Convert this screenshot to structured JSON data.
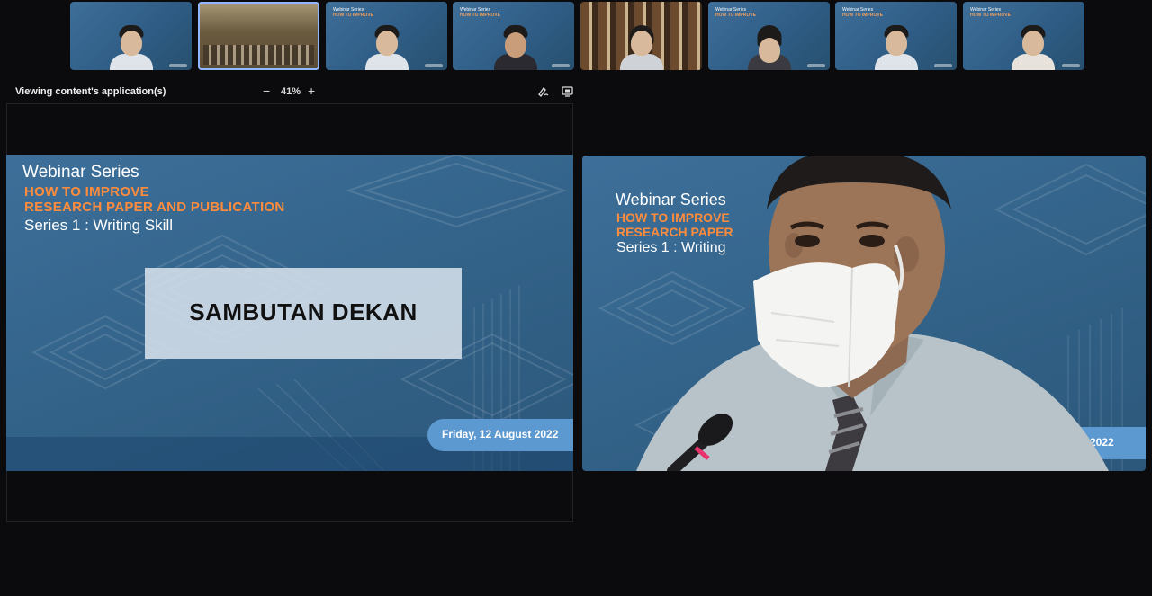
{
  "participants": [
    {
      "kind": "person"
    },
    {
      "kind": "room"
    },
    {
      "kind": "person"
    },
    {
      "kind": "person"
    },
    {
      "kind": "shelf"
    },
    {
      "kind": "person"
    },
    {
      "kind": "person"
    },
    {
      "kind": "person"
    }
  ],
  "view_bar": {
    "label": "Viewing content's application(s)",
    "zoom_minus": "−",
    "zoom_value": "41%",
    "zoom_plus": "+",
    "annotate_icon": "annotate-icon",
    "screen_icon": "screen-share-icon"
  },
  "slide": {
    "series_title": "Webinar Series",
    "headline_line1": "HOW TO IMPROVE",
    "headline_line2": "RESEARCH PAPER AND PUBLICATION",
    "subtitle": "Series 1 : Writing Skill",
    "box_text": "SAMBUTAN DEKAN",
    "date": "Friday, 12 August 2022"
  },
  "speaker_video": {
    "series_title": "Webinar Series",
    "headline_line1": "HOW TO IMPROVE",
    "headline_line2": "RESEARCH PAPER",
    "subtitle": "Series 1 : Writing",
    "date_fragment": "ugust 2022"
  },
  "colors": {
    "slide_blue": "#336389",
    "accent_orange": "#ff8c3c",
    "date_pill": "#5c99d0",
    "background": "#0b0a0c"
  }
}
